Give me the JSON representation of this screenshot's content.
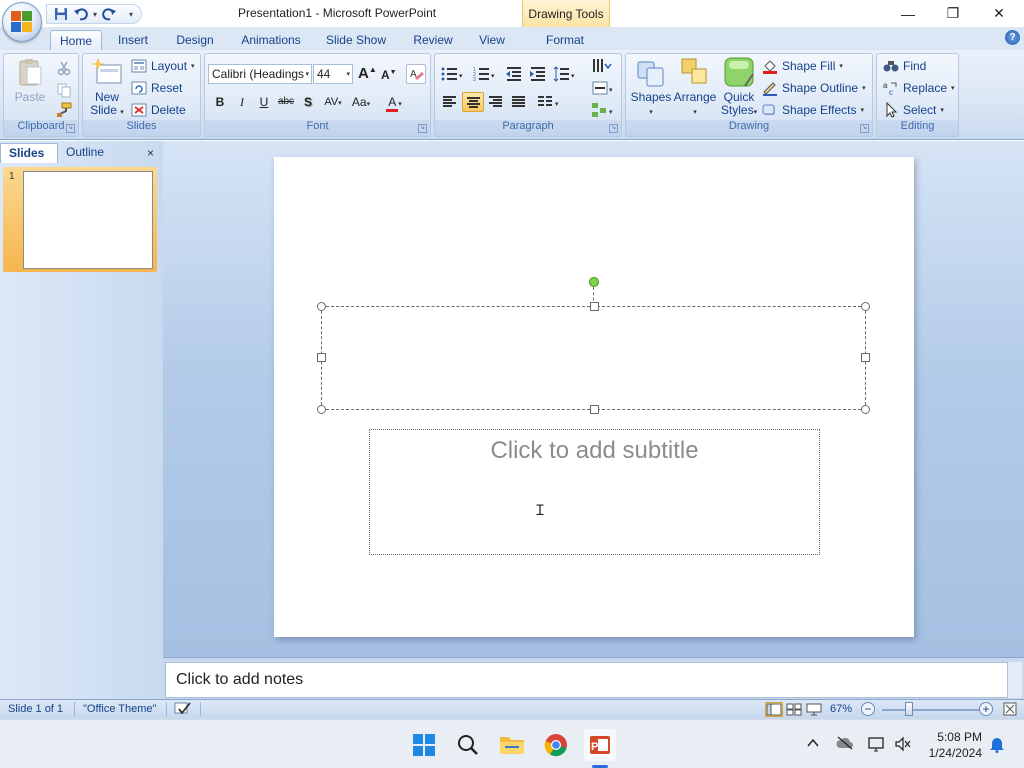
{
  "window": {
    "title": "Presentation1 - Microsoft PowerPoint",
    "contextual_tab_group": "Drawing Tools",
    "minimize": "—",
    "maximize": "❐",
    "close": "✕"
  },
  "qat": {
    "more": "▾"
  },
  "tabs": [
    {
      "label": "Home",
      "active": true
    },
    {
      "label": "Insert"
    },
    {
      "label": "Design"
    },
    {
      "label": "Animations"
    },
    {
      "label": "Slide Show"
    },
    {
      "label": "Review"
    },
    {
      "label": "View"
    },
    {
      "label": "Format"
    }
  ],
  "help": "?",
  "ribbon": {
    "clipboard": {
      "label": "Clipboard",
      "paste": "Paste"
    },
    "slides": {
      "label": "Slides",
      "new_slide_line1": "New",
      "new_slide_line2": "Slide",
      "layout": "Layout",
      "reset": "Reset",
      "delete": "Delete"
    },
    "font": {
      "label": "Font",
      "font_name": "Calibri (Headings",
      "font_size": "44",
      "grow": "A",
      "shrink": "A",
      "bold": "B",
      "italic": "I",
      "underline": "U",
      "strike": "abc",
      "shadow": "S",
      "spacing": "AV",
      "case": "Aa",
      "color": "A"
    },
    "paragraph": {
      "label": "Paragraph"
    },
    "drawing": {
      "label": "Drawing",
      "shapes": "Shapes",
      "arrange": "Arrange",
      "quick_styles_line1": "Quick",
      "quick_styles_line2": "Styles",
      "shape_fill": "Shape Fill",
      "shape_outline": "Shape Outline",
      "shape_effects": "Shape Effects"
    },
    "editing": {
      "label": "Editing",
      "find": "Find",
      "replace": "Replace",
      "select": "Select"
    }
  },
  "pane": {
    "tab_slides": "Slides",
    "tab_outline": "Outline",
    "close": "×",
    "thumb_number": "1"
  },
  "slide": {
    "subtitle_placeholder": "Click to add subtitle"
  },
  "notes": {
    "placeholder": "Click to add notes"
  },
  "status": {
    "slide_info": "Slide 1 of 1",
    "theme": "\"Office Theme\"",
    "zoom": "67%",
    "zoom_minus": "−",
    "zoom_plus": "+"
  },
  "taskbar": {
    "time": "5:08 PM",
    "date": "1/24/2024"
  },
  "colors": {
    "ribbon_bg": "#dbe6f4",
    "accent_selected": "#fbc85a",
    "slide_bg_top": "#d6e4f5",
    "rotate_handle": "#7fd34d",
    "font_color_red": "#e02020"
  }
}
